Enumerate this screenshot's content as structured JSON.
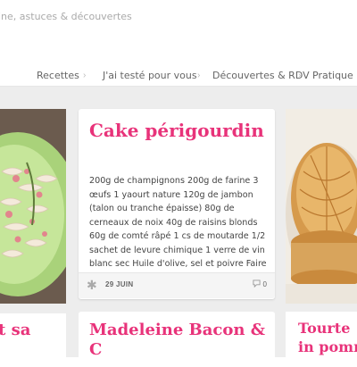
{
  "header": {
    "tagline": "ine, astuces & découvertes"
  },
  "nav": {
    "items": [
      {
        "label": "Recettes"
      },
      {
        "label": "J'ai testé pour vous"
      },
      {
        "label": "Découvertes & RDV"
      },
      {
        "label": "Pratique"
      }
    ],
    "separator": "›"
  },
  "posts": {
    "left_bottom_title": "t sa",
    "main": {
      "title": "Cake périgourdin",
      "excerpt": "200g de champignons 200g de farine 3 œufs 1 yaourt nature 120g de jambon (talon ou tranche épaisse) 80g de cerneaux de noix 40g de raisins blonds 60g de comté râpé 1 cs de moutarde 1/2 sachet de levure chimique 1 verre de vin blanc sec Huile d'olive, sel et poivre Faire tremper les raisons [...]",
      "date": "29 JUIN",
      "comments": "0"
    },
    "center_bottom_title": "Madeleine Bacon & C",
    "right_bottom_title": "Tourte in pommes"
  },
  "colors": {
    "accent": "#e8337a",
    "background": "#ededed",
    "card": "#ffffff"
  },
  "icons": {
    "date_icon": "asterisk-icon",
    "comment_icon": "comment-bubble-icon"
  }
}
